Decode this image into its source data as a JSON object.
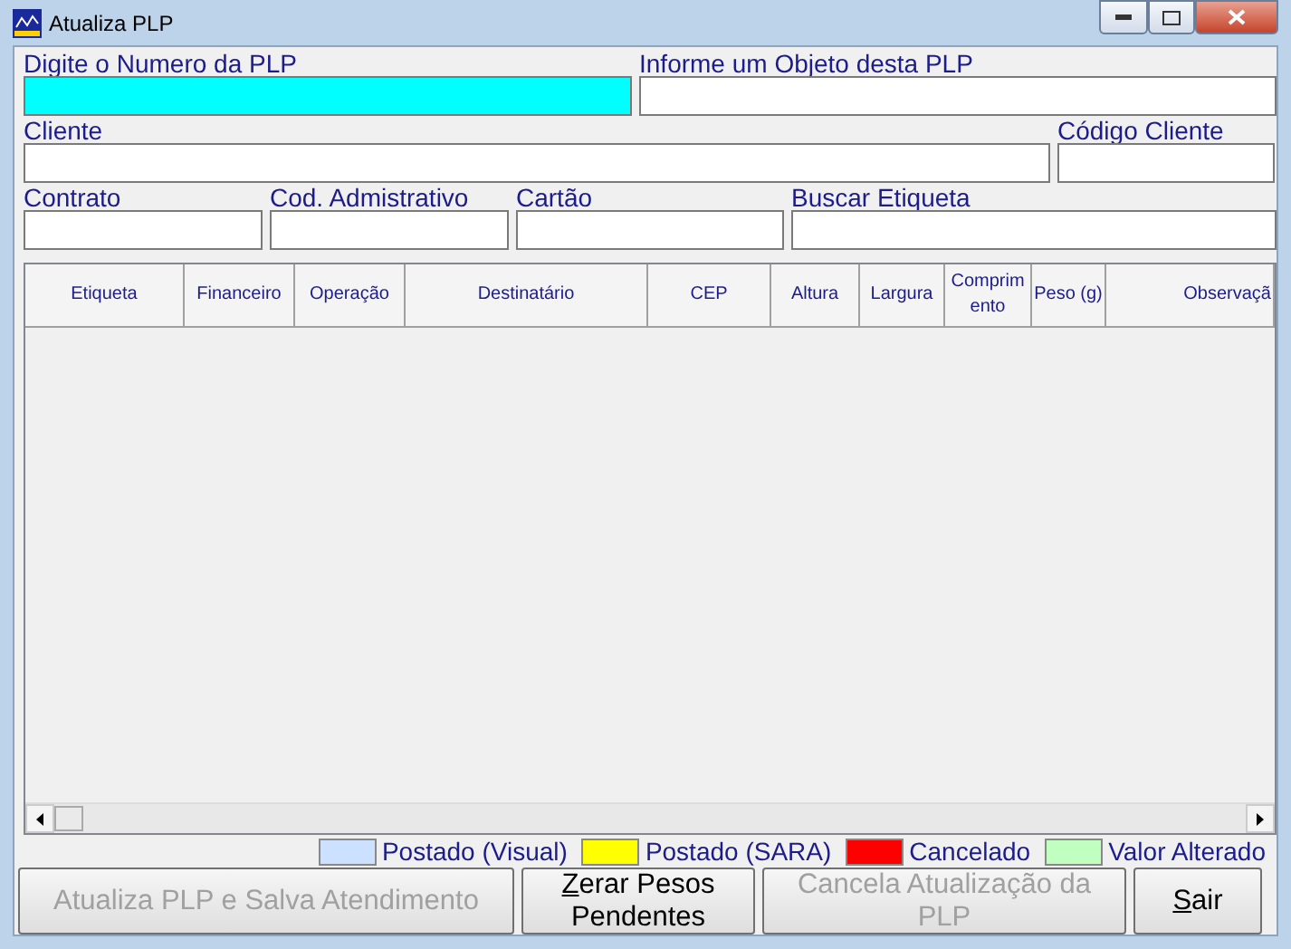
{
  "window": {
    "title": "Atualiza PLP"
  },
  "field_rows": [
    [
      {
        "label": "Digite o Numero da PLP",
        "focused": true
      },
      {
        "label": "Informe um Objeto desta PLP",
        "focused": false
      }
    ],
    [
      {
        "label": "Cliente",
        "focused": false
      },
      {
        "label": "Código Cliente",
        "focused": false
      }
    ],
    [
      {
        "label": "Contrato",
        "focused": false
      },
      {
        "label": "Cod. Admistrativo",
        "focused": false
      },
      {
        "label": "Cartão",
        "focused": false
      },
      {
        "label": "Buscar Etiqueta",
        "focused": false
      }
    ]
  ],
  "table": {
    "columns": [
      "Etiqueta",
      "Financeiro",
      "Operação",
      "Destinatário",
      "CEP",
      "Altura",
      "Largura",
      "Comprimento",
      "Peso (g)",
      "Observaçã"
    ]
  },
  "legend": [
    {
      "label": "Postado (Visual)",
      "color": "#cce0ff"
    },
    {
      "label": "Postado (SARA)",
      "color": "#ffff00"
    },
    {
      "label": "Cancelado",
      "color": "#ff0000"
    },
    {
      "label": "Valor Alterado",
      "color": "#c0ffc0"
    }
  ],
  "buttons": [
    {
      "label": "Atualiza PLP e Salva Atendimento",
      "disabled": true
    },
    {
      "label": "Zerar Pesos Pendentes",
      "disabled": false,
      "underline_first": true
    },
    {
      "label": "Cancela Atualização da PLP",
      "disabled": true
    },
    {
      "label": "Sair",
      "disabled": false,
      "underline_first": true
    }
  ]
}
